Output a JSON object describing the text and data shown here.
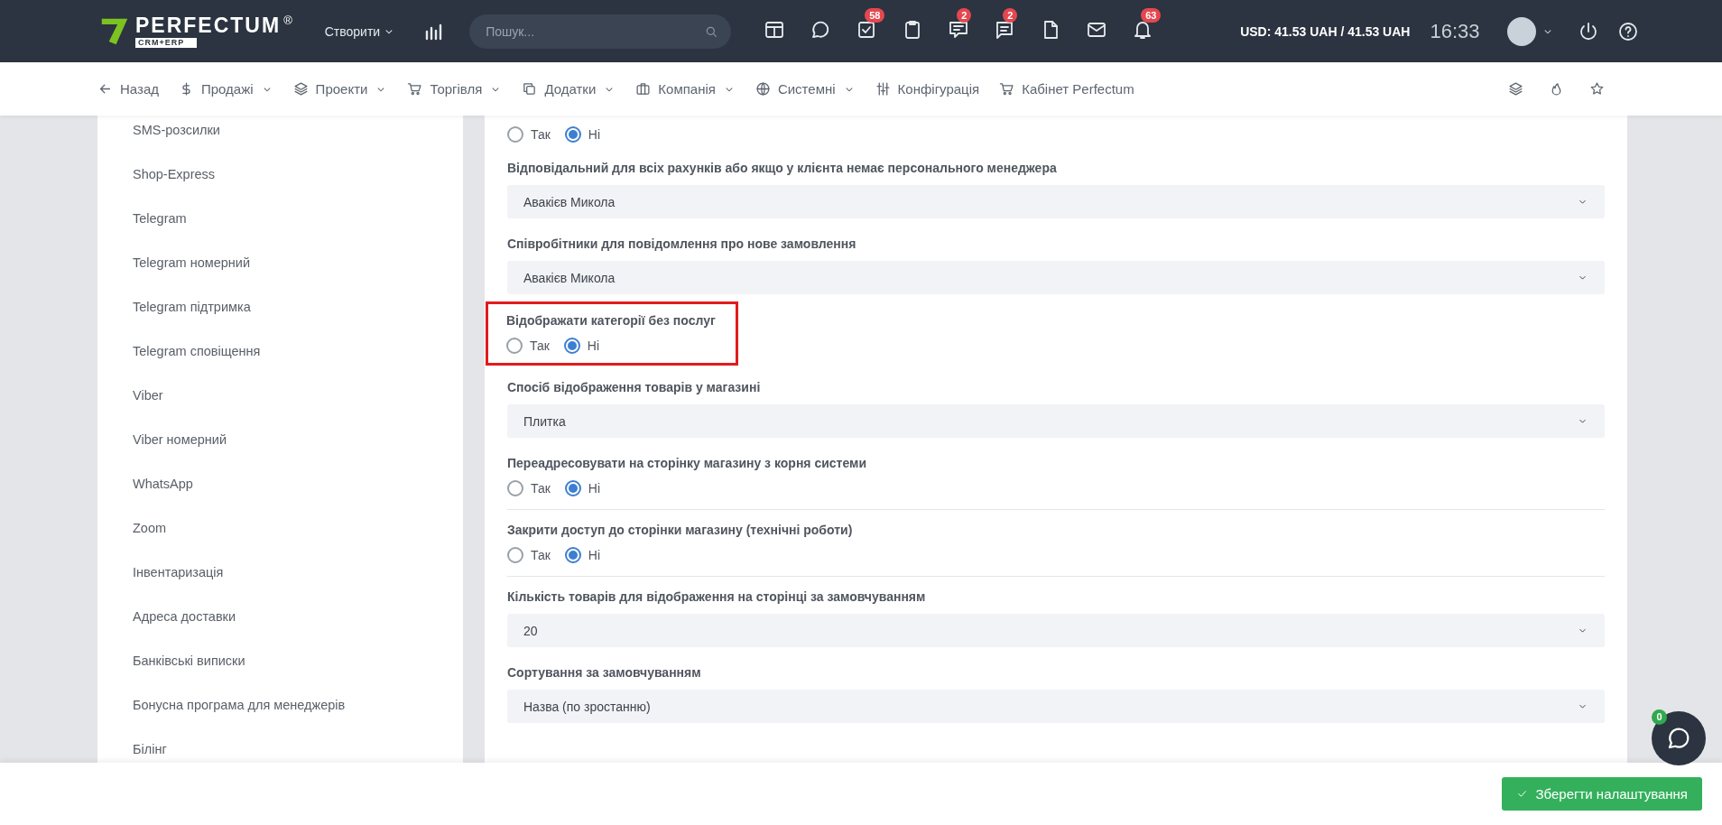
{
  "header": {
    "logo": {
      "name": "PERFECTUM",
      "mark": "®",
      "sub": "CRM+ERP"
    },
    "create": "Створити",
    "search": {
      "placeholder": "Пошук..."
    },
    "toolbar": [
      {
        "kind": "layout"
      },
      {
        "kind": "chat"
      },
      {
        "kind": "tasks",
        "badge": "58"
      },
      {
        "kind": "clipboard"
      },
      {
        "kind": "comments",
        "badge": "2"
      },
      {
        "kind": "messages",
        "badge": "2"
      },
      {
        "kind": "file"
      },
      {
        "kind": "mail"
      },
      {
        "kind": "bell",
        "badge": "63"
      }
    ],
    "currency": "USD: 41.53 UAH / 41.53 UAH",
    "time": "16:33"
  },
  "nav": [
    {
      "kind": "back",
      "label": "Назад",
      "dropdown": false
    },
    {
      "kind": "dollar",
      "label": "Продажі",
      "dropdown": true
    },
    {
      "kind": "layers",
      "label": "Проекти",
      "dropdown": true
    },
    {
      "kind": "cart",
      "label": "Торгівля",
      "dropdown": true
    },
    {
      "kind": "copy",
      "label": "Додатки",
      "dropdown": true
    },
    {
      "kind": "briefcase",
      "label": "Компанія",
      "dropdown": true
    },
    {
      "kind": "globe",
      "label": "Системні",
      "dropdown": true
    },
    {
      "kind": "sliders",
      "label": "Конфігурація",
      "dropdown": false
    },
    {
      "kind": "cart",
      "label": "Кабінет Perfectum",
      "dropdown": false
    }
  ],
  "sidebar": {
    "items": [
      "SMS-розсилки",
      "Shop-Express",
      "Telegram",
      "Telegram номерний",
      "Telegram підтримка",
      "Telegram сповіщення",
      "Viber",
      "Viber номерний",
      "WhatsApp",
      "Zoom",
      "Інвентаризація",
      "Адреса доставки",
      "Банківські виписки",
      "Бонусна програма для менеджерів",
      "Білінг"
    ]
  },
  "fields": [
    {
      "kind": "radio",
      "highlighted": false,
      "divider": false,
      "options": [
        {
          "label": "Так",
          "selected": false
        },
        {
          "label": "Ні",
          "selected": true
        }
      ]
    },
    {
      "kind": "select",
      "label": "Відповідальний для всіх рахунків або якщо у клієнта немає персонального менеджера",
      "value": "Авакієв Микола",
      "highlighted": false,
      "divider": false
    },
    {
      "kind": "select",
      "label": "Співробітники для повідомлення про нове замовлення",
      "value": "Авакієв Микола",
      "highlighted": false,
      "divider": false
    },
    {
      "kind": "radio",
      "label": "Відображати категорії без послуг",
      "highlighted": true,
      "divider": false,
      "options": [
        {
          "label": "Так",
          "selected": false
        },
        {
          "label": "Ні",
          "selected": true
        }
      ]
    },
    {
      "kind": "select",
      "label": "Спосіб відображення товарів у магазині",
      "value": "Плитка",
      "highlighted": false,
      "divider": false
    },
    {
      "kind": "radio",
      "label": "Переадресовувати на сторінку магазину з корня системи",
      "highlighted": false,
      "divider": true,
      "options": [
        {
          "label": "Так",
          "selected": false
        },
        {
          "label": "Ні",
          "selected": true
        }
      ]
    },
    {
      "kind": "radio",
      "label": "Закрити доступ до сторінки магазину (технічні роботи)",
      "highlighted": false,
      "divider": true,
      "options": [
        {
          "label": "Так",
          "selected": false
        },
        {
          "label": "Ні",
          "selected": true
        }
      ]
    },
    {
      "kind": "select",
      "label": "Кількість товарів для відображення на сторінці за замовчуванням",
      "value": "20",
      "highlighted": false,
      "divider": false
    },
    {
      "kind": "select",
      "label": "Сортування за замовчуванням",
      "value": "Назва (по зростанню)",
      "highlighted": false,
      "divider": false
    }
  ],
  "chat_widget": {
    "badge": "0"
  },
  "footer": {
    "save": "Зберегти налаштування"
  }
}
